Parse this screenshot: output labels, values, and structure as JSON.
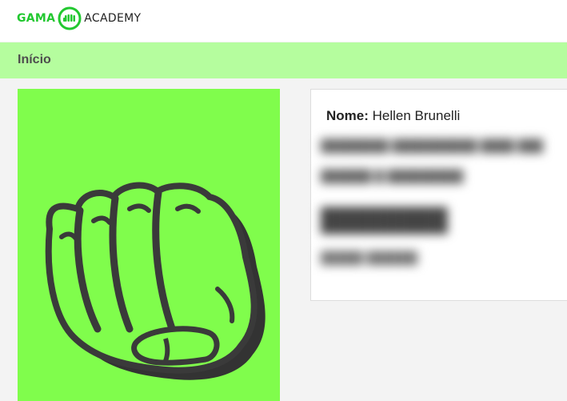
{
  "header": {
    "logo_left": "GAMA",
    "logo_right": "ACADEMY",
    "brand_color": "#22c830"
  },
  "breadcrumb": {
    "title": "Início",
    "bar_color": "#b5fd9e"
  },
  "profile": {
    "photo_bg": "#80fd4c",
    "photo_icon": "fist-icon",
    "name_label": "Nome:",
    "name_value": "Hellen Brunelli",
    "blurred": {
      "line1": "████████ ██████████ ████ ███",
      "line2": "██████ █ █████████",
      "line3": "████████",
      "line4": "█████ ██████"
    }
  }
}
